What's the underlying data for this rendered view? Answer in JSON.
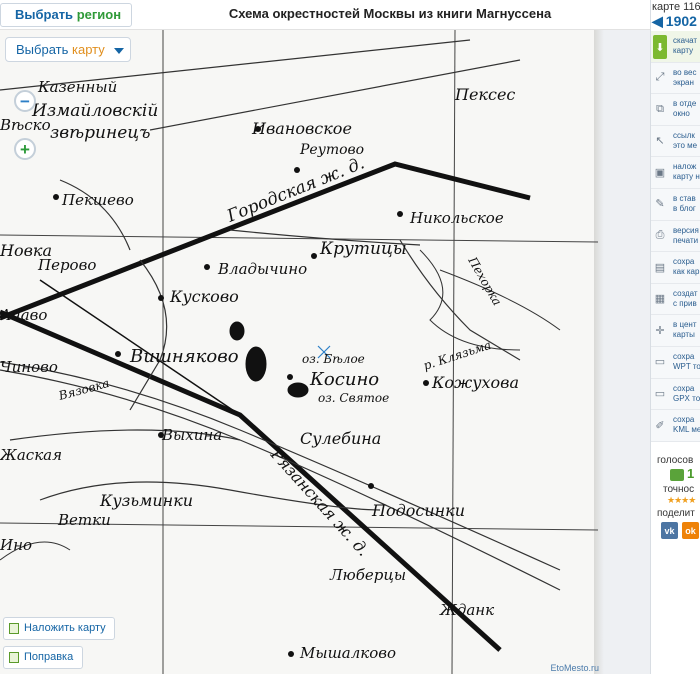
{
  "header": {
    "region_button_prefix": "Выбрать",
    "region_button_accent": "регион",
    "title": "Схема окрестностей Москвы из книги Магнуссена"
  },
  "map_controls": {
    "select_map_prefix": "Выбрать",
    "select_map_accent": "карту",
    "zoom_out": "−",
    "zoom_in": "+",
    "overlay_label": "Наложить карту",
    "fix_label": "Поправка",
    "credit": "EtoMesto.ru"
  },
  "right_panel": {
    "map_count": "карте 116",
    "year": "1902",
    "items": [
      {
        "icon": "download-icon",
        "glyph": "⬇",
        "text": "скачат\nкарту"
      },
      {
        "icon": "fullscreen-icon",
        "glyph": "⤢",
        "text": "во вес\nэкран"
      },
      {
        "icon": "new-window-icon",
        "glyph": "⧉",
        "text": "в отде\nокно"
      },
      {
        "icon": "cursor-link-icon",
        "glyph": "↖",
        "text": "ссылк\nэто ме"
      },
      {
        "icon": "layers-icon",
        "glyph": "▣",
        "text": "налож\nкарту н"
      },
      {
        "icon": "embed-icon",
        "glyph": "✎",
        "text": "в став\nв блог"
      },
      {
        "icon": "print-icon",
        "glyph": "⎙",
        "text": "версия\nпечати"
      },
      {
        "icon": "save-image-icon",
        "glyph": "▤",
        "text": "сохра\nкак кар"
      },
      {
        "icon": "grid-icon",
        "glyph": "▦",
        "text": "создат\nс прив"
      },
      {
        "icon": "center-icon",
        "glyph": "✛",
        "text": "в цент\nкарты"
      },
      {
        "icon": "wpt-file-icon",
        "glyph": "▭",
        "text": "сохра\nWPT то"
      },
      {
        "icon": "gpx-file-icon",
        "glyph": "▭",
        "text": "сохра\nGPX то"
      },
      {
        "icon": "kml-file-icon",
        "glyph": "✐",
        "text": "сохра\nKML ме"
      }
    ],
    "vote_label": "голосов",
    "vote_count": "1",
    "accuracy_label": "точнос",
    "stars": "★★★★",
    "share_label": "поделит",
    "social": [
      "vk",
      "ok"
    ]
  },
  "map_labels": [
    "Казенный",
    "Измайловскій",
    "звѣринецъ",
    "Ивановское",
    "Реутово",
    "Пекшево",
    "Городская ж. д.",
    "Никольское",
    "Крутицы",
    "Перово",
    "Владычино",
    "Кусково",
    "Вишняково",
    "Косино",
    "оз. Бѣлое",
    "оз. Святое",
    "р. Клязьма",
    "Кожухова",
    "Вязовка",
    "Выхина",
    "Сулебина",
    "Рязанская ж. д.",
    "Кузьминки",
    "Ветки",
    "Подосинки",
    "Люберцы",
    "Жданк",
    "Мышалково",
    "Пехорка",
    "Пексес",
    "Новка",
    "Вѣско",
    "Ачаво",
    "Чиново",
    "Жаская",
    "Ино"
  ]
}
